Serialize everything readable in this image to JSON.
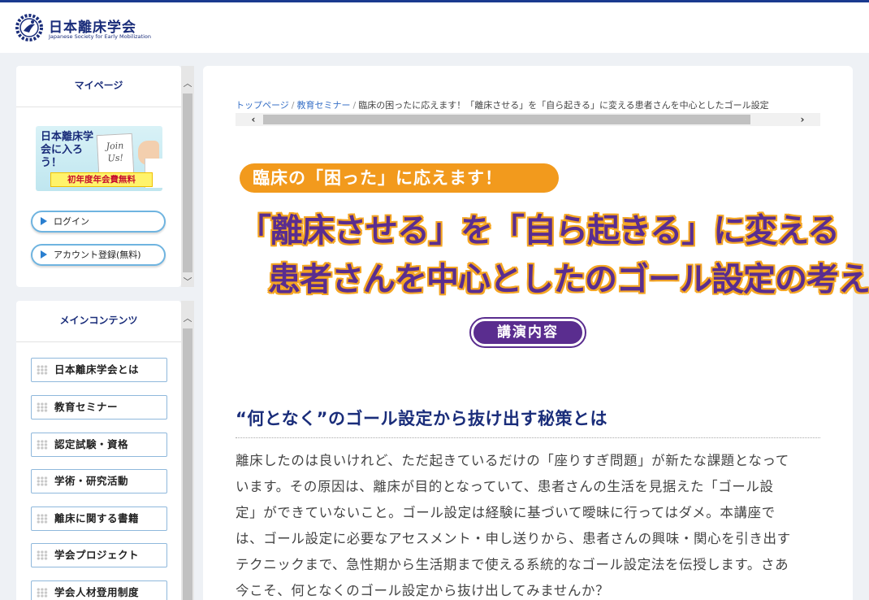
{
  "header": {
    "logo_jp": "日本離床学会",
    "logo_en": "Japanese Society for Early Mobilization"
  },
  "mypage": {
    "title": "マイページ",
    "banner": {
      "text": "日本離床学会に入ろう！",
      "card": "Join Us!",
      "footer": "初年度年会費無料"
    },
    "login_label": "ログイン",
    "register_label": "アカウント登録(無料)"
  },
  "main_contents": {
    "title": "メインコンテンツ",
    "items": [
      {
        "label": "日本離床学会とは"
      },
      {
        "label": "教育セミナー"
      },
      {
        "label": "認定試験・資格"
      },
      {
        "label": "学術・研究活動"
      },
      {
        "label": "離床に関する書籍"
      },
      {
        "label": "学会プロジェクト"
      },
      {
        "label": "学会人材登用制度"
      }
    ]
  },
  "breadcrumb": {
    "home": "トップページ",
    "seminar": "教育セミナー",
    "current": "臨床の困ったに応えます！「離床させる」を「自ら起きる」に変える患者さんを中心としたゴール設定"
  },
  "hero": {
    "tag": "臨床の「困った」に応えます！",
    "line1": "「離床させる」を「自ら起きる」に変える",
    "line2": "患者さんを中心としたのゴール設定の考え方"
  },
  "lecture_badge": "講演内容",
  "section": {
    "heading": "“何となく”のゴール設定から抜け出す秘策とは",
    "lines": [
      "離床したのは良いけれど、ただ起きているだけの「座りすぎ問題」が新たな課題となって",
      "います。その原因は、離床が目的となっていて、患者さんの生活を見据えた「ゴール設",
      "定」ができていないこと。ゴール設定は経験に基づいて曖昧に行ってはダメ。本講座で",
      "は、ゴール設定に必要なアセスメント・申し送りから、患者さんの興味・関心を引き出す",
      "テクニックまで、急性期から生活期まで使える系統的なゴール設定法を伝授します。さあ",
      "今こそ、何となくのゴール設定から抜け出してみませんか？"
    ]
  },
  "colors": {
    "brand_navy": "#1a2d7a",
    "hero_purple": "#5a2d8f",
    "hero_orange": "#f29a1d",
    "link_blue": "#3a72c7"
  }
}
